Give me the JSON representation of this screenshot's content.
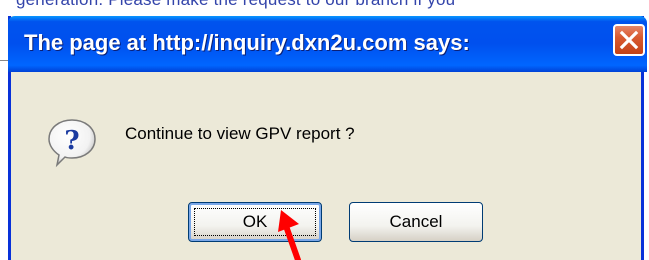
{
  "background": {
    "page_text": "generation. Please make the request to our branch if you"
  },
  "dialog": {
    "title": "The page at http://inquiry.dxn2u.com says:",
    "message": "Continue to view GPV report ?",
    "buttons": {
      "ok_label": "OK",
      "cancel_label": "Cancel"
    },
    "icon": "question-icon",
    "close_icon": "close-icon"
  },
  "annotation": {
    "arrow_icon": "red-pointer-arrow-icon",
    "arrow_color": "#ff0000"
  },
  "colors": {
    "titlebar": "#0050ee",
    "dialog_bg": "#ece9d8",
    "close_button": "#d95a30"
  }
}
